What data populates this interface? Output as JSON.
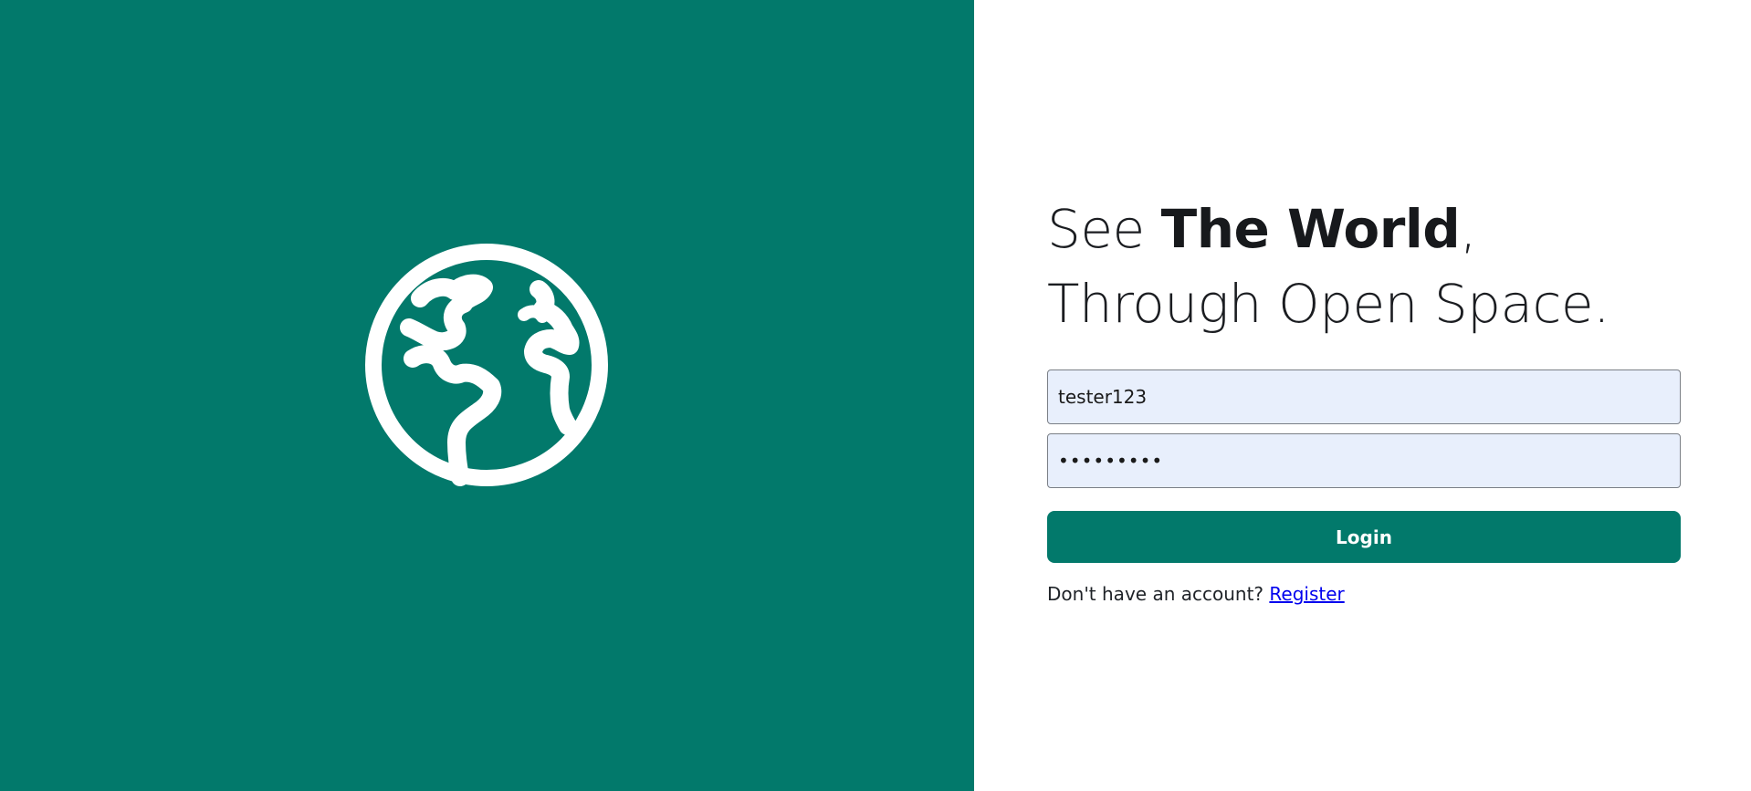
{
  "brand": {
    "panel_color": "#02796b",
    "icon": "globe-icon"
  },
  "headline": {
    "prefix": "See ",
    "emphasis": "The World",
    "comma": ",",
    "line2": "Through Open Space."
  },
  "form": {
    "username_value": "tester123",
    "password_value": "•••••••••",
    "login_label": "Login",
    "register_prompt": "Don't have an account? ",
    "register_link": "Register"
  },
  "colors": {
    "accent": "#02796b",
    "input_bg": "#e8effc",
    "link": "#0000ee"
  }
}
